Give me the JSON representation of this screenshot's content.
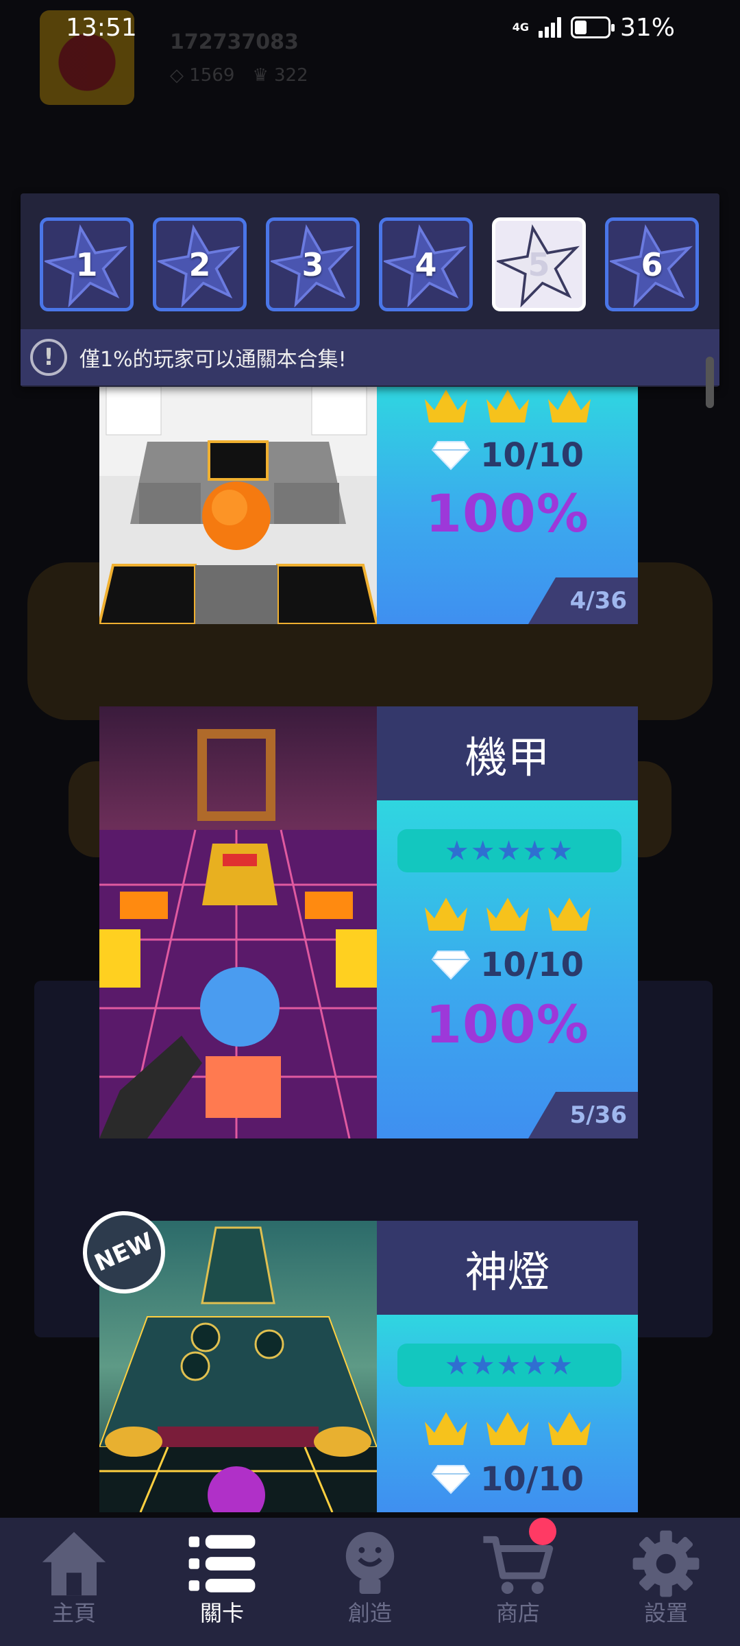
{
  "status_bar": {
    "time": "13:51",
    "network": "4G",
    "battery": "31%"
  },
  "profile": {
    "player_id": "172737083",
    "diamonds": "1569",
    "crowns": "322"
  },
  "collection_tabs": [
    {
      "label": "1",
      "active": false
    },
    {
      "label": "2",
      "active": false
    },
    {
      "label": "3",
      "active": false
    },
    {
      "label": "4",
      "active": false
    },
    {
      "label": "5",
      "active": true
    },
    {
      "label": "6",
      "active": false
    }
  ],
  "notice": {
    "text": "僅1%的玩家可以通關本合集!"
  },
  "levels": [
    {
      "name": "",
      "gems": "10/10",
      "percent": "100%",
      "count": "4/36",
      "crowns": 3,
      "is_new": false,
      "theme": "white"
    },
    {
      "name": "機甲",
      "gems": "10/10",
      "percent": "100%",
      "count": "5/36",
      "crowns": 3,
      "rating_stars": "★★★★★",
      "is_new": false,
      "theme": "mecha"
    },
    {
      "name": "神燈",
      "gems": "10/10",
      "percent": "",
      "count": "",
      "crowns": 3,
      "rating_stars": "★★★★★",
      "is_new": true,
      "new_label": "NEW",
      "theme": "lamp"
    }
  ],
  "nav": [
    {
      "label": "主頁",
      "icon": "home-icon",
      "active": false
    },
    {
      "label": "關卡",
      "icon": "list-icon",
      "active": true
    },
    {
      "label": "創造",
      "icon": "lightbulb-icon",
      "active": false
    },
    {
      "label": "商店",
      "icon": "cart-icon",
      "active": false,
      "badge": true
    },
    {
      "label": "設置",
      "icon": "gear-icon",
      "active": false
    }
  ],
  "colors": {
    "accent": "#4a76e8",
    "header_bg": "#23243b",
    "card_gradient_top": "#2fd6e0",
    "percent": "#9d38d9",
    "notification": "#ff3a64"
  }
}
